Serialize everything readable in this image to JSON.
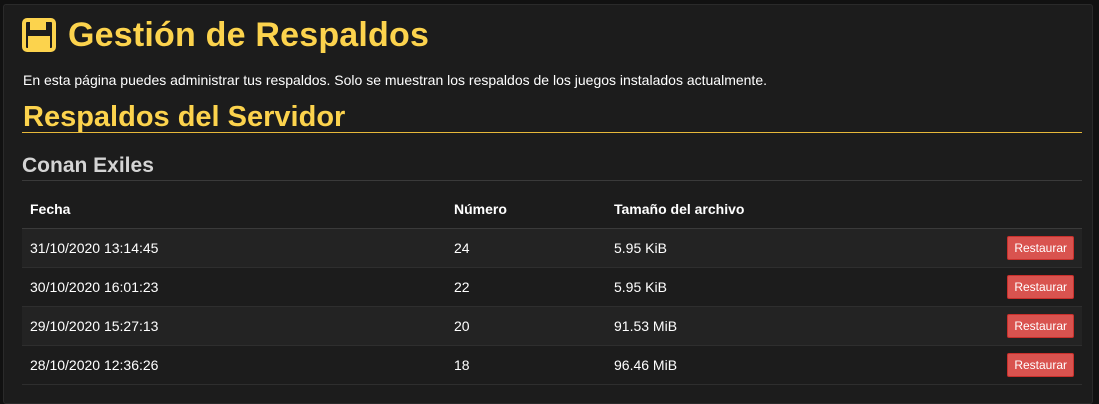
{
  "header": {
    "title": "Gestión de Respaldos",
    "icon": "floppy-disk-icon",
    "accent_color": "#fcd34d"
  },
  "intro_text": "En esta página puedes administrar tus respaldos. Solo se muestran los respaldos de los juegos instalados actualmente.",
  "section": {
    "title": "Respaldos del Servidor"
  },
  "game": {
    "name": "Conan Exiles",
    "columns": {
      "fecha": "Fecha",
      "numero": "Número",
      "tamano": "Tamaño del archivo"
    },
    "rows": [
      {
        "fecha": "31/10/2020 13:14:45",
        "numero": "24",
        "tamano": "5.95 KiB",
        "action": "Restaurar"
      },
      {
        "fecha": "30/10/2020 16:01:23",
        "numero": "22",
        "tamano": "5.95 KiB",
        "action": "Restaurar"
      },
      {
        "fecha": "29/10/2020 15:27:13",
        "numero": "20",
        "tamano": "91.53 MiB",
        "action": "Restaurar"
      },
      {
        "fecha": "28/10/2020 12:36:26",
        "numero": "18",
        "tamano": "96.46 MiB",
        "action": "Restaurar"
      }
    ],
    "button_color": "#d9534f"
  }
}
